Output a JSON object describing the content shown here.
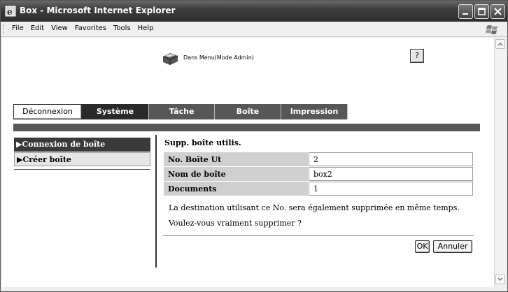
{
  "window": {
    "title": "Box - Microsoft Internet Explorer",
    "menu": [
      "File",
      "Edit",
      "View",
      "Favorites",
      "Tools",
      "Help"
    ]
  },
  "header": {
    "mode_text": "Dans Menu(Mode Admin)",
    "help_label": "?"
  },
  "tabs": {
    "logout_label": "Déconnexion",
    "items": [
      {
        "label": "Système",
        "state": "active"
      },
      {
        "label": "Tâche",
        "state": "inactive"
      },
      {
        "label": "Boîte",
        "state": "inactive"
      },
      {
        "label": "Impression",
        "state": "inactive"
      }
    ]
  },
  "sidebar": {
    "items": [
      {
        "label": "▶Connexion de boîte",
        "selected": true
      },
      {
        "label": "▶Créer boîte",
        "selected": false
      }
    ]
  },
  "main": {
    "title": "Supp. boîte utilis.",
    "rows": [
      {
        "key": "No. Boîte Ut",
        "value": "2"
      },
      {
        "key": "Nom de boîte",
        "value": "box2"
      },
      {
        "key": "Documents",
        "value": "1"
      }
    ],
    "message_1": "La destination utilisant ce No. sera également supprimée en même temps.",
    "message_2": "Voulez-vous vraiment supprimer ?",
    "ok_label": "OK",
    "cancel_label": "Annuler"
  },
  "colors": {
    "tab_active": "#2a2a2a",
    "tab_inactive": "#575757",
    "nav_selected": "#3a3a3a",
    "key_cell": "#cfcfcf"
  }
}
